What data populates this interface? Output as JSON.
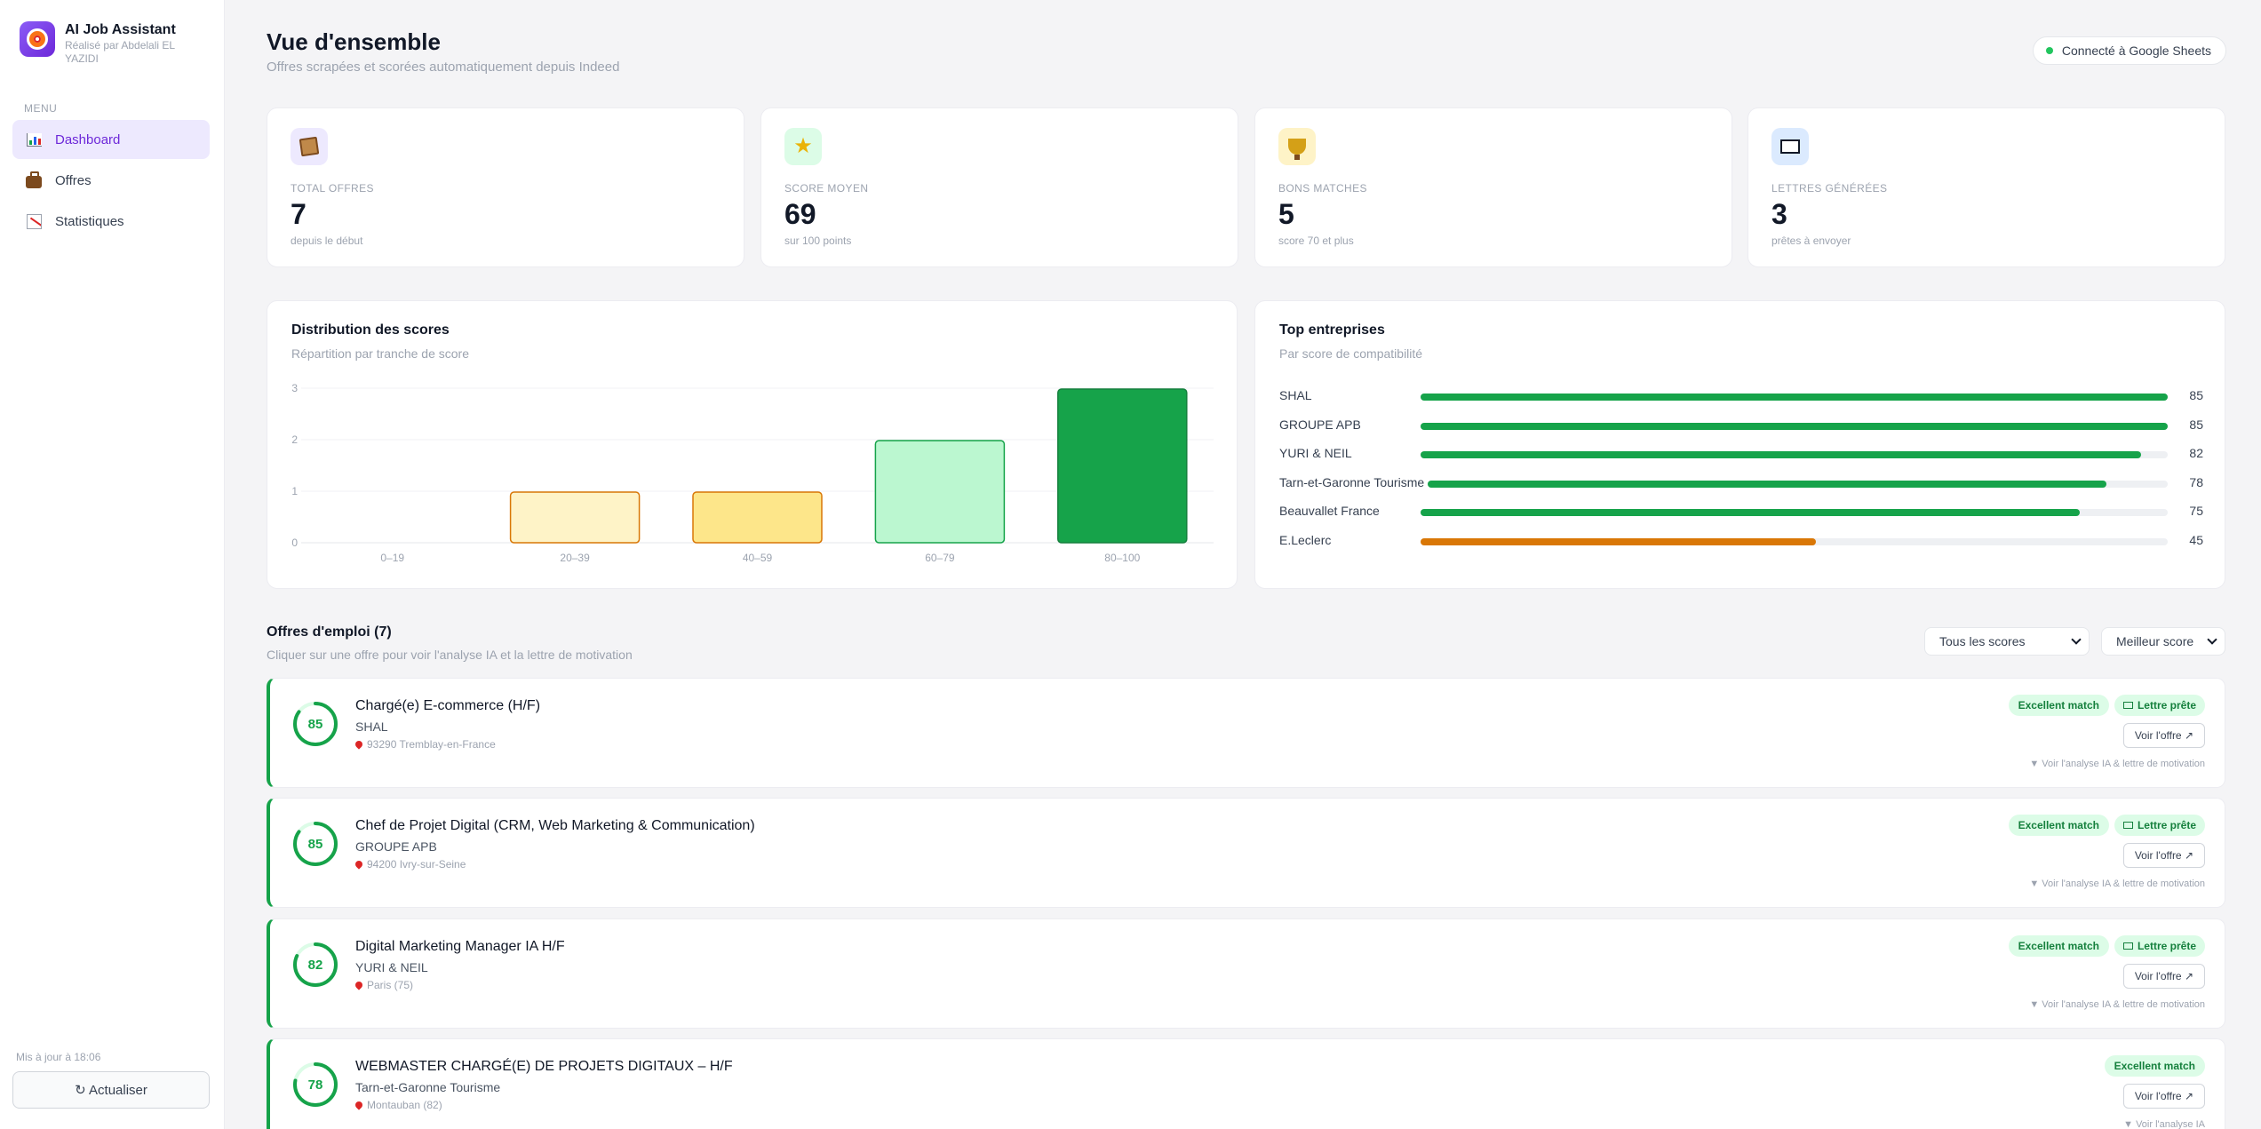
{
  "sidebar": {
    "brand_name": "AI Job Assistant",
    "brand_sub": "Réalisé par Abdelali EL YAZIDI",
    "menu_label": "MENU",
    "items": [
      {
        "label": "Dashboard",
        "icon": "chart-icon",
        "active": true
      },
      {
        "label": "Offres",
        "icon": "briefcase-icon",
        "active": false
      },
      {
        "label": "Statistiques",
        "icon": "trend-icon",
        "active": false
      }
    ],
    "updated": "Mis à jour à 18:06",
    "refresh_label": "↻ Actualiser"
  },
  "header": {
    "title": "Vue d'ensemble",
    "subtitle": "Offres scrapées et scorées automatiquement depuis Indeed",
    "connection": "Connecté à Google Sheets"
  },
  "stats": [
    {
      "label": "TOTAL OFFRES",
      "value": "7",
      "note": "depuis le début",
      "icon": "box-icon",
      "icon_bg": "#ede9fe"
    },
    {
      "label": "SCORE MOYEN",
      "value": "69",
      "note": "sur 100 points",
      "icon": "star-icon",
      "icon_bg": "#dcfce7"
    },
    {
      "label": "BONS MATCHES",
      "value": "5",
      "note": "score 70 et plus",
      "icon": "trophy-icon",
      "icon_bg": "#fef3c7"
    },
    {
      "label": "LETTRES GÉNÉRÉES",
      "value": "3",
      "note": "prêtes à envoyer",
      "icon": "frame-icon",
      "icon_bg": "#dbeafe"
    }
  ],
  "chart_data": {
    "type": "bar",
    "title": "Distribution des scores",
    "subtitle": "Répartition par tranche de score",
    "categories": [
      "0–19",
      "20–39",
      "40–59",
      "60–79",
      "80–100"
    ],
    "values": [
      0,
      1,
      1,
      2,
      3
    ],
    "colors": [
      "#fef3c7",
      "#fef3c7",
      "#fde68a",
      "#bbf7d0",
      "#16a34a"
    ],
    "strokes": [
      "#d97706",
      "#d97706",
      "#d97706",
      "#16a34a",
      "#15803d"
    ],
    "yticks": [
      "0",
      "1",
      "2",
      "3"
    ],
    "ylim": [
      0,
      3
    ],
    "grid": true
  },
  "top_companies": {
    "title": "Top entreprises",
    "subtitle": "Par score de compatibilité",
    "items": [
      {
        "name": "SHAL",
        "score": 85,
        "color": "#16a34a"
      },
      {
        "name": "GROUPE APB",
        "score": 85,
        "color": "#16a34a"
      },
      {
        "name": "YURI & NEIL",
        "score": 82,
        "color": "#16a34a"
      },
      {
        "name": "Tarn-et-Garonne Tourisme",
        "score": 78,
        "color": "#16a34a"
      },
      {
        "name": "Beauvallet France",
        "score": 75,
        "color": "#16a34a"
      },
      {
        "name": "E.Leclerc",
        "score": 45,
        "color": "#d97706"
      }
    ]
  },
  "offers": {
    "title": "Offres d'emploi (7)",
    "subtitle": "Cliquer sur une offre pour voir l'analyse IA et la lettre de motivation",
    "filter_score": "Tous les scores",
    "sort": "Meilleur score",
    "voir_label": "Voir l'offre ↗",
    "items": [
      {
        "score": 85,
        "title": "Chargé(e) E-commerce (H/F)",
        "company": "SHAL",
        "location": "93290 Tremblay-en-France",
        "match": "Excellent match",
        "letter": "Lettre prête",
        "analyse": "▼ Voir l'analyse IA & lettre de motivation"
      },
      {
        "score": 85,
        "title": "Chef de Projet Digital (CRM, Web Marketing & Communication)",
        "company": "GROUPE APB",
        "location": "94200 Ivry-sur-Seine",
        "match": "Excellent match",
        "letter": "Lettre prête",
        "analyse": "▼ Voir l'analyse IA & lettre de motivation"
      },
      {
        "score": 82,
        "title": "Digital Marketing Manager IA H/F",
        "company": "YURI & NEIL",
        "location": "Paris (75)",
        "match": "Excellent match",
        "letter": "Lettre prête",
        "analyse": "▼ Voir l'analyse IA & lettre de motivation"
      },
      {
        "score": 78,
        "title": "WEBMASTER CHARGÉ(E) DE PROJETS DIGITAUX – H/F",
        "company": "Tarn-et-Garonne Tourisme",
        "location": "Montauban (82)",
        "match": "Excellent match",
        "letter": "",
        "analyse": "▼ Voir l'analyse IA"
      }
    ]
  }
}
